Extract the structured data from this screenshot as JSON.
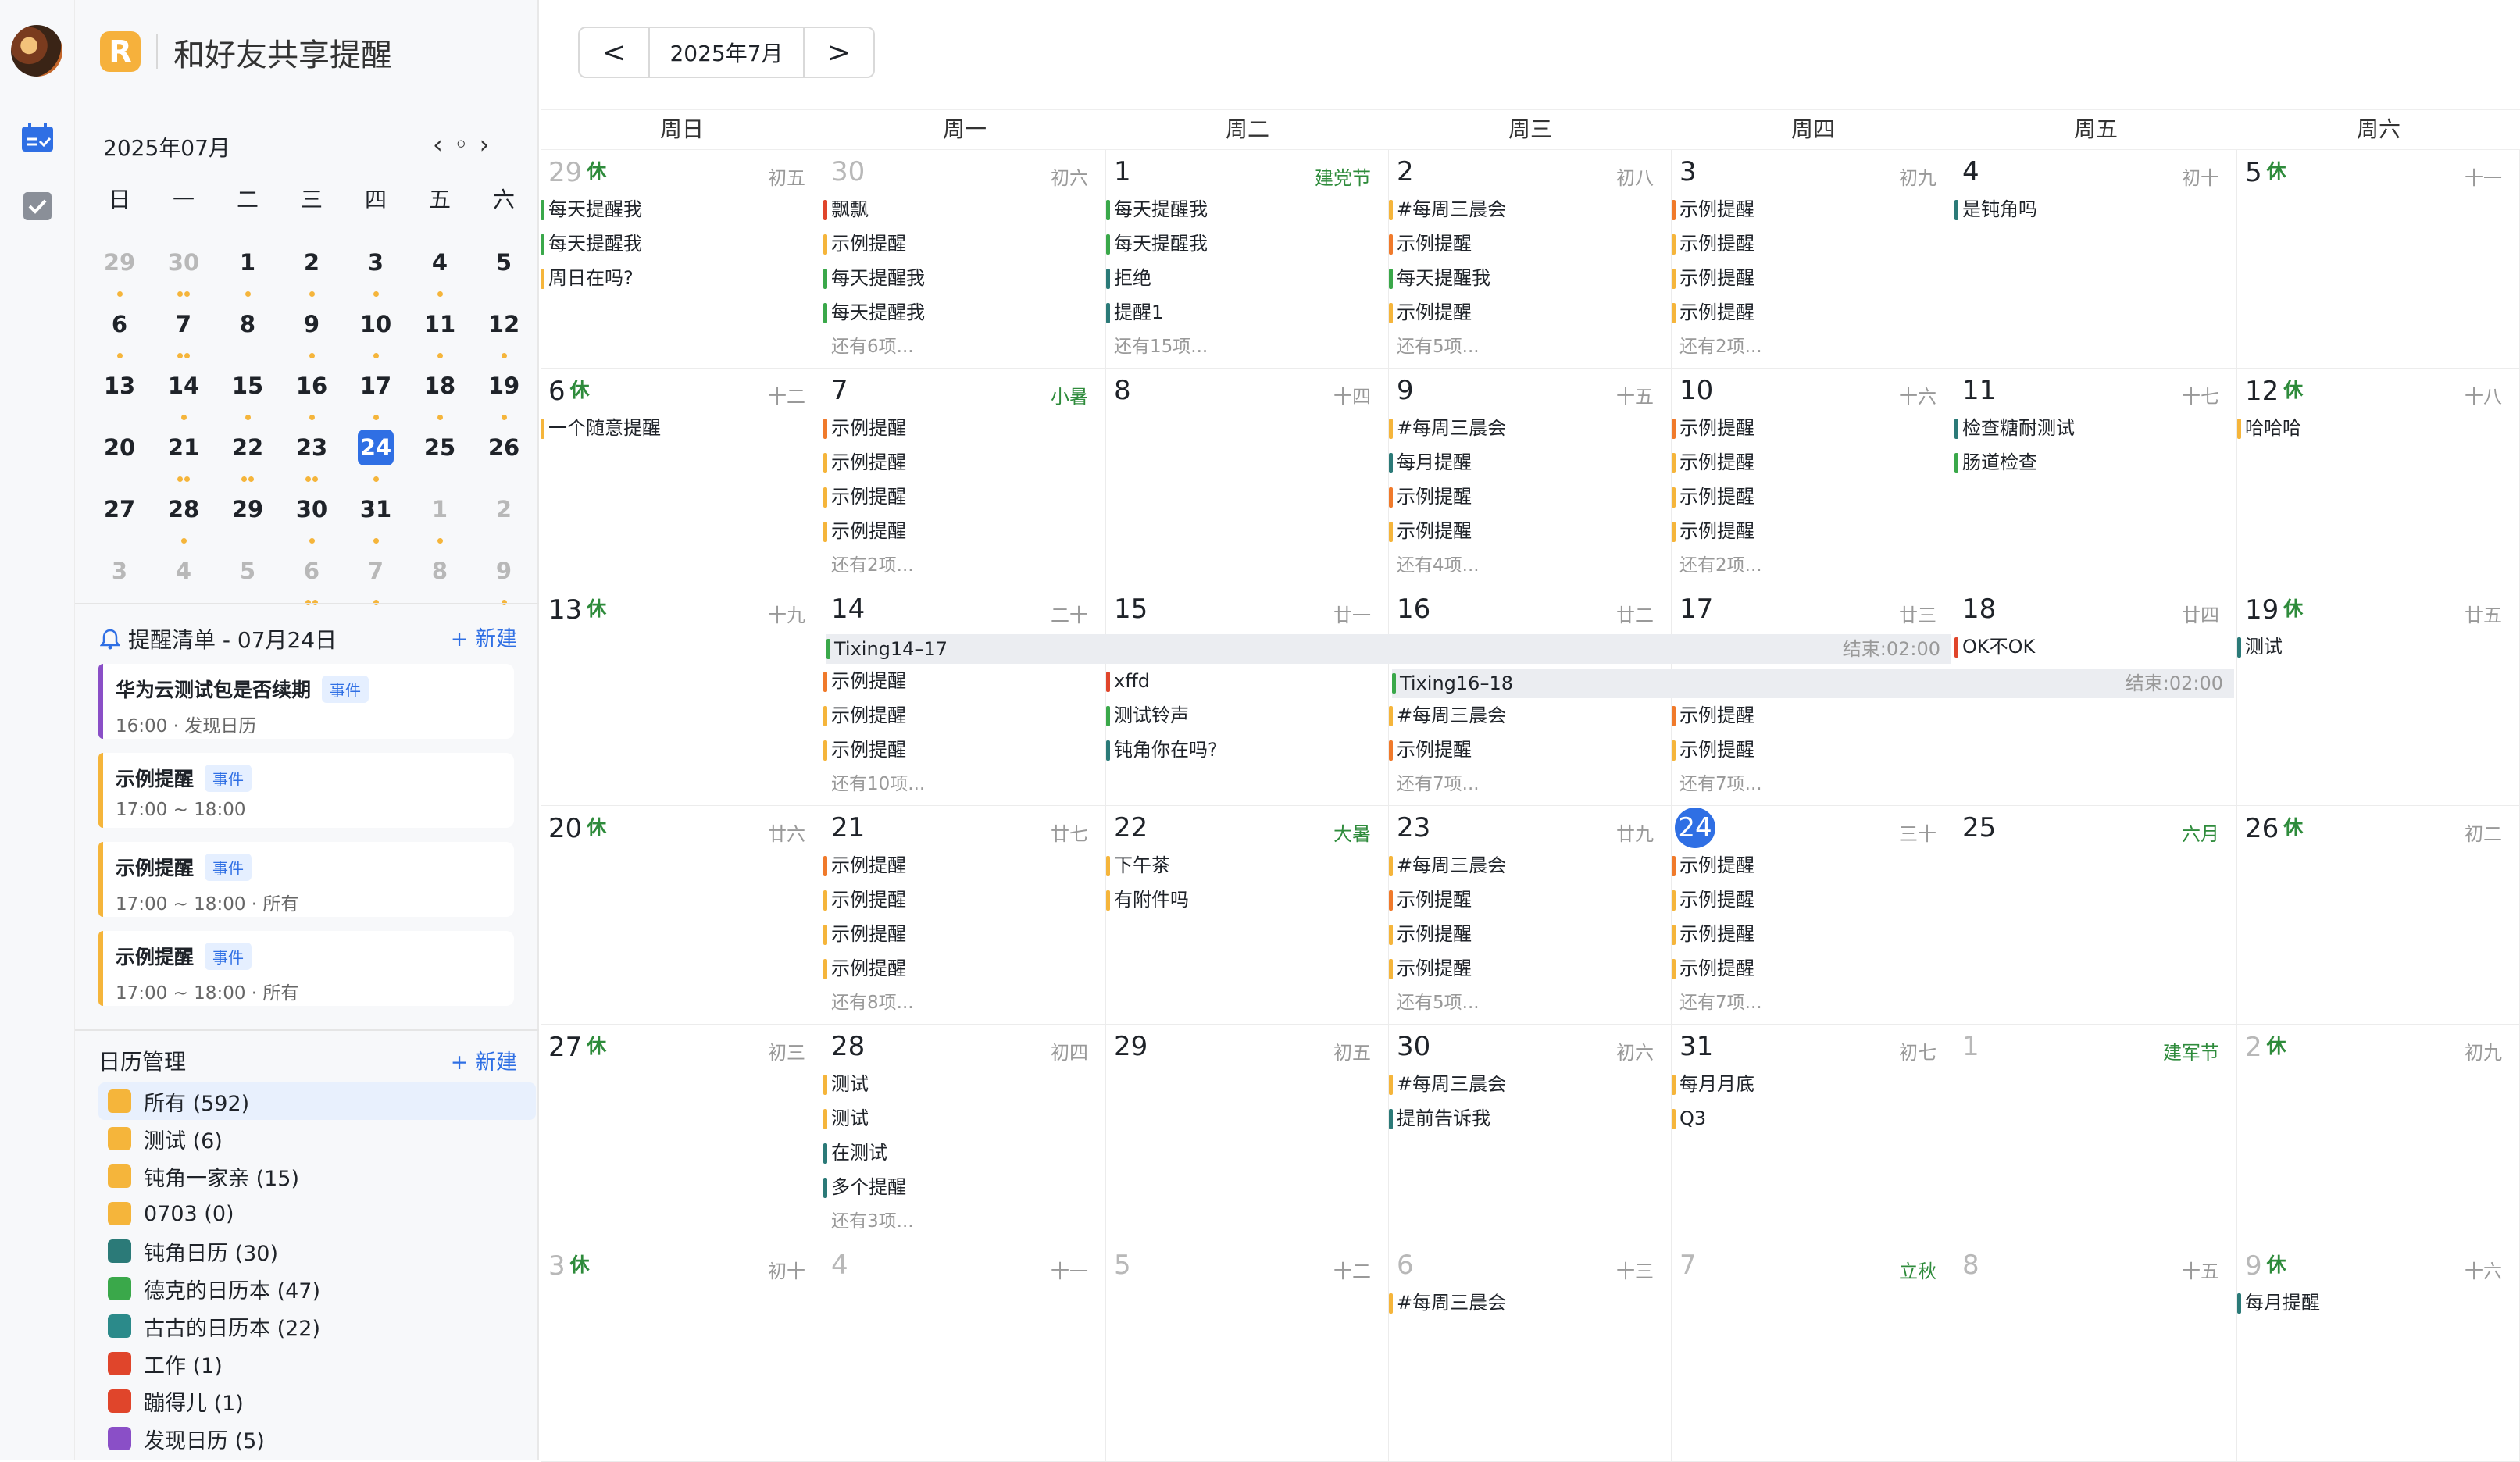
{
  "app": {
    "title": "和好友共享提醒",
    "logo": "R"
  },
  "toolbar": {
    "prev": "<",
    "month": "2025年7月",
    "next": ">"
  },
  "mini": {
    "title": "2025年07月",
    "prev": "‹",
    "today": "◦",
    "next": "›",
    "weekdays": [
      "日",
      "一",
      "二",
      "三",
      "四",
      "五",
      "六"
    ],
    "rows": [
      [
        {
          "d": "29",
          "dim": true,
          "dots": 1
        },
        {
          "d": "30",
          "dim": true,
          "dots": 2
        },
        {
          "d": "1",
          "dots": 1
        },
        {
          "d": "2",
          "dots": 1
        },
        {
          "d": "3",
          "dots": 1
        },
        {
          "d": "4",
          "dots": 1
        },
        {
          "d": "5",
          "dots": 0
        }
      ],
      [
        {
          "d": "6",
          "dots": 1
        },
        {
          "d": "7",
          "dots": 2
        },
        {
          "d": "8",
          "dots": 0
        },
        {
          "d": "9",
          "dots": 1
        },
        {
          "d": "10",
          "dots": 1
        },
        {
          "d": "11",
          "dots": 1
        },
        {
          "d": "12",
          "dots": 1
        }
      ],
      [
        {
          "d": "13",
          "dots": 0
        },
        {
          "d": "14",
          "dots": 1
        },
        {
          "d": "15",
          "dots": 1
        },
        {
          "d": "16",
          "dots": 1
        },
        {
          "d": "17",
          "dots": 1
        },
        {
          "d": "18",
          "dots": 1
        },
        {
          "d": "19",
          "dots": 1
        }
      ],
      [
        {
          "d": "20",
          "dots": 0
        },
        {
          "d": "21",
          "dots": 2
        },
        {
          "d": "22",
          "dots": 2
        },
        {
          "d": "23",
          "dots": 2
        },
        {
          "d": "24",
          "today": true,
          "dots": 1
        },
        {
          "d": "25",
          "dots": 0
        },
        {
          "d": "26",
          "dots": 0
        }
      ],
      [
        {
          "d": "27",
          "dots": 0
        },
        {
          "d": "28",
          "dots": 1
        },
        {
          "d": "29",
          "dots": 0
        },
        {
          "d": "30",
          "dots": 1
        },
        {
          "d": "31",
          "dots": 1
        },
        {
          "d": "1",
          "dim": true,
          "dots": 1
        },
        {
          "d": "2",
          "dim": true,
          "dots": 0
        }
      ],
      [
        {
          "d": "3",
          "dim": true,
          "dots": 0
        },
        {
          "d": "4",
          "dim": true,
          "dots": 0
        },
        {
          "d": "5",
          "dim": true,
          "dots": 0
        },
        {
          "d": "6",
          "dim": true,
          "dots": 2
        },
        {
          "d": "7",
          "dim": true,
          "dots": 1
        },
        {
          "d": "8",
          "dim": true,
          "dots": 0
        },
        {
          "d": "9",
          "dim": true,
          "dots": 1
        }
      ]
    ]
  },
  "reminders": {
    "title": "提醒清单 - 07月24日",
    "new": "+ 新建",
    "items": [
      {
        "title": "华为云测试包是否续期",
        "tag": "事件",
        "sub": "16:00 · 发现日历",
        "color": "#8a4fc7"
      },
      {
        "title": "示例提醒",
        "tag": "事件",
        "sub": "17:00 ~ 18:00",
        "color": "#f5b53b"
      },
      {
        "title": "示例提醒",
        "tag": "事件",
        "sub": "17:00 ~ 18:00 · 所有",
        "color": "#f5b53b"
      },
      {
        "title": "示例提醒",
        "tag": "事件",
        "sub": "17:00 ~ 18:00 · 所有",
        "color": "#f5b53b"
      }
    ]
  },
  "calendars": {
    "title": "日历管理",
    "new": "+ 新建",
    "items": [
      {
        "label": "所有 (592)",
        "color": "#f5b53b",
        "sel": true
      },
      {
        "label": "测试 (6)",
        "color": "#f5b53b"
      },
      {
        "label": "钝角一家亲 (15)",
        "color": "#f5b53b"
      },
      {
        "label": "0703 (0)",
        "color": "#f5b53b"
      },
      {
        "label": "钝角日历 (30)",
        "color": "#2b7a78"
      },
      {
        "label": "德克的日历本 (47)",
        "color": "#3aa84a"
      },
      {
        "label": "古古的日历本 (22)",
        "color": "#2b8a8a"
      },
      {
        "label": "工作 (1)",
        "color": "#e0452b"
      },
      {
        "label": "蹦得儿 (1)",
        "color": "#e0452b"
      },
      {
        "label": "发现日历 (5)",
        "color": "#8a4fc7"
      }
    ]
  },
  "weekdays": [
    "周日",
    "周一",
    "周二",
    "周三",
    "周四",
    "周五",
    "周六"
  ],
  "weeks": [
    {
      "days": [
        {
          "d": "29",
          "dim": true,
          "rest": "休",
          "lunar": "初五",
          "events": [
            [
              "每天提醒我",
              "#3aa84a"
            ],
            [
              "每天提醒我",
              "#3aa84a"
            ],
            [
              "周日在吗?",
              "#f5b53b"
            ]
          ]
        },
        {
          "d": "30",
          "dim": true,
          "lunar": "初六",
          "events": [
            [
              "飘飘",
              "#e0452b"
            ],
            [
              "示例提醒",
              "#f5b53b"
            ],
            [
              "每天提醒我",
              "#3aa84a"
            ],
            [
              "每天提醒我",
              "#3aa84a"
            ]
          ],
          "more": "还有6项..."
        },
        {
          "d": "1",
          "lunar": "建党节",
          "fest": true,
          "events": [
            [
              "每天提醒我",
              "#3aa84a"
            ],
            [
              "每天提醒我",
              "#3aa84a"
            ],
            [
              "拒绝",
              "#2b7a78"
            ],
            [
              "提醒1",
              "#2b7a78"
            ]
          ],
          "more": "还有15项..."
        },
        {
          "d": "2",
          "lunar": "初八",
          "events": [
            [
              "#每周三晨会",
              "#f5b53b"
            ],
            [
              "示例提醒",
              "#f07a2b"
            ],
            [
              "每天提醒我",
              "#3aa84a"
            ],
            [
              "示例提醒",
              "#f5b53b"
            ]
          ],
          "more": "还有5项..."
        },
        {
          "d": "3",
          "lunar": "初九",
          "events": [
            [
              "示例提醒",
              "#f07a2b"
            ],
            [
              "示例提醒",
              "#f5b53b"
            ],
            [
              "示例提醒",
              "#f5b53b"
            ],
            [
              "示例提醒",
              "#f5b53b"
            ]
          ],
          "more": "还有2项..."
        },
        {
          "d": "4",
          "lunar": "初十",
          "events": [
            [
              "是钝角吗",
              "#2b7a78"
            ]
          ]
        },
        {
          "d": "5",
          "rest": "休",
          "lunar": "十一",
          "events": []
        }
      ]
    },
    {
      "days": [
        {
          "d": "6",
          "rest": "休",
          "lunar": "十二",
          "events": [
            [
              "一个随意提醒",
              "#f5b53b"
            ]
          ]
        },
        {
          "d": "7",
          "lunar": "小暑",
          "fest": true,
          "events": [
            [
              "示例提醒",
              "#f07a2b"
            ],
            [
              "示例提醒",
              "#f5b53b"
            ],
            [
              "示例提醒",
              "#f5b53b"
            ],
            [
              "示例提醒",
              "#f5b53b"
            ]
          ],
          "more": "还有2项..."
        },
        {
          "d": "8",
          "lunar": "十四",
          "events": []
        },
        {
          "d": "9",
          "lunar": "十五",
          "events": [
            [
              "#每周三晨会",
              "#f5b53b"
            ],
            [
              "每月提醒",
              "#2b7a78"
            ],
            [
              "示例提醒",
              "#f07a2b"
            ],
            [
              "示例提醒",
              "#f5b53b"
            ]
          ],
          "more": "还有4项..."
        },
        {
          "d": "10",
          "lunar": "十六",
          "events": [
            [
              "示例提醒",
              "#f07a2b"
            ],
            [
              "示例提醒",
              "#f5b53b"
            ],
            [
              "示例提醒",
              "#f5b53b"
            ],
            [
              "示例提醒",
              "#f5b53b"
            ]
          ],
          "more": "还有2项..."
        },
        {
          "d": "11",
          "lunar": "十七",
          "events": [
            [
              "检查糖耐测试",
              "#2b7a78"
            ],
            [
              "肠道检查",
              "#3aa84a"
            ]
          ]
        },
        {
          "d": "12",
          "rest": "休",
          "lunar": "十八",
          "events": [
            [
              "哈哈哈",
              "#f5b53b"
            ]
          ]
        }
      ]
    },
    {
      "days": [
        {
          "d": "13",
          "rest": "休",
          "lunar": "十九",
          "events": []
        },
        {
          "d": "14",
          "lunar": "二十",
          "events": [
            [
              "",
              "#fff"
            ],
            [
              "示例提醒",
              "#f07a2b"
            ],
            [
              "示例提醒",
              "#f5b53b"
            ],
            [
              "示例提醒",
              "#f5b53b"
            ]
          ],
          "more": "还有10项..."
        },
        {
          "d": "15",
          "lunar": "廿一",
          "events": [
            [
              "",
              "#fff"
            ],
            [
              "xffd",
              "#e0452b"
            ],
            [
              "测试铃声",
              "#3aa84a"
            ],
            [
              "钝角你在吗?",
              "#2b7a78"
            ]
          ]
        },
        {
          "d": "16",
          "lunar": "廿二",
          "events": [
            [
              "",
              "#fff"
            ],
            [
              "",
              "#fff"
            ],
            [
              "#每周三晨会",
              "#f5b53b"
            ],
            [
              "示例提醒",
              "#f07a2b"
            ]
          ],
          "more": "还有7项..."
        },
        {
          "d": "17",
          "lunar": "廿三",
          "events": [
            [
              "",
              "#fff"
            ],
            [
              "",
              "#fff"
            ],
            [
              "示例提醒",
              "#f07a2b"
            ],
            [
              "示例提醒",
              "#f5b53b"
            ]
          ],
          "more": "还有7项..."
        },
        {
          "d": "18",
          "lunar": "廿四",
          "events": [
            [
              "OK不OK",
              "#e0452b"
            ]
          ]
        },
        {
          "d": "19",
          "rest": "休",
          "lunar": "廿五",
          "events": [
            [
              "测试",
              "#2b7a78"
            ]
          ]
        }
      ],
      "spans": [
        {
          "label": "Tixing14–17",
          "end": "结束:02:00",
          "start": 1,
          "len": 4,
          "row": 0,
          "color": "#3aa84a"
        },
        {
          "label": "Tixing16–18",
          "end": "结束:02:00",
          "start": 3,
          "len": 3,
          "row": 1,
          "color": "#3aa84a"
        }
      ]
    },
    {
      "days": [
        {
          "d": "20",
          "rest": "休",
          "lunar": "廿六",
          "events": []
        },
        {
          "d": "21",
          "lunar": "廿七",
          "events": [
            [
              "示例提醒",
              "#f07a2b"
            ],
            [
              "示例提醒",
              "#f5b53b"
            ],
            [
              "示例提醒",
              "#f5b53b"
            ],
            [
              "示例提醒",
              "#f5b53b"
            ]
          ],
          "more": "还有8项..."
        },
        {
          "d": "22",
          "lunar": "大暑",
          "fest": true,
          "events": [
            [
              "下午茶",
              "#f5b53b"
            ],
            [
              "有附件吗",
              "#f5b53b"
            ]
          ]
        },
        {
          "d": "23",
          "lunar": "廿九",
          "events": [
            [
              "#每周三晨会",
              "#f5b53b"
            ],
            [
              "示例提醒",
              "#f07a2b"
            ],
            [
              "示例提醒",
              "#f5b53b"
            ],
            [
              "示例提醒",
              "#f5b53b"
            ]
          ],
          "more": "还有5项..."
        },
        {
          "d": "24",
          "today": true,
          "lunar": "三十",
          "events": [
            [
              "示例提醒",
              "#f07a2b"
            ],
            [
              "示例提醒",
              "#f5b53b"
            ],
            [
              "示例提醒",
              "#f5b53b"
            ],
            [
              "示例提醒",
              "#f5b53b"
            ]
          ],
          "more": "还有7项..."
        },
        {
          "d": "25",
          "lunar": "六月",
          "fest": true,
          "events": []
        },
        {
          "d": "26",
          "rest": "休",
          "lunar": "初二",
          "events": []
        }
      ]
    },
    {
      "days": [
        {
          "d": "27",
          "rest": "休",
          "lunar": "初三",
          "events": []
        },
        {
          "d": "28",
          "lunar": "初四",
          "events": [
            [
              "测试",
              "#f5b53b"
            ],
            [
              "测试",
              "#f5b53b"
            ],
            [
              "在测试",
              "#2b7a78"
            ],
            [
              "多个提醒",
              "#2b7a78"
            ]
          ],
          "more": "还有3项..."
        },
        {
          "d": "29",
          "lunar": "初五",
          "events": []
        },
        {
          "d": "30",
          "lunar": "初六",
          "events": [
            [
              "#每周三晨会",
              "#f5b53b"
            ],
            [
              "提前告诉我",
              "#2b7a78"
            ]
          ]
        },
        {
          "d": "31",
          "lunar": "初七",
          "events": [
            [
              "每月月底",
              "#f5b53b"
            ],
            [
              "Q3",
              "#f5b53b"
            ]
          ]
        },
        {
          "d": "1",
          "dim": true,
          "lunar": "建军节",
          "fest": true,
          "events": []
        },
        {
          "d": "2",
          "dim": true,
          "rest": "休",
          "lunar": "初九",
          "events": []
        }
      ]
    },
    {
      "days": [
        {
          "d": "3",
          "dim": true,
          "rest": "休",
          "lunar": "初十",
          "events": []
        },
        {
          "d": "4",
          "dim": true,
          "lunar": "十一",
          "events": []
        },
        {
          "d": "5",
          "dim": true,
          "lunar": "十二",
          "events": []
        },
        {
          "d": "6",
          "dim": true,
          "lunar": "十三",
          "events": [
            [
              "#每周三晨会",
              "#f5b53b"
            ]
          ]
        },
        {
          "d": "7",
          "dim": true,
          "lunar": "立秋",
          "fest": true,
          "events": []
        },
        {
          "d": "8",
          "dim": true,
          "lunar": "十五",
          "events": []
        },
        {
          "d": "9",
          "dim": true,
          "rest": "休",
          "lunar": "十六",
          "events": [
            [
              "每月提醒",
              "#2b7a78"
            ]
          ]
        }
      ]
    }
  ]
}
